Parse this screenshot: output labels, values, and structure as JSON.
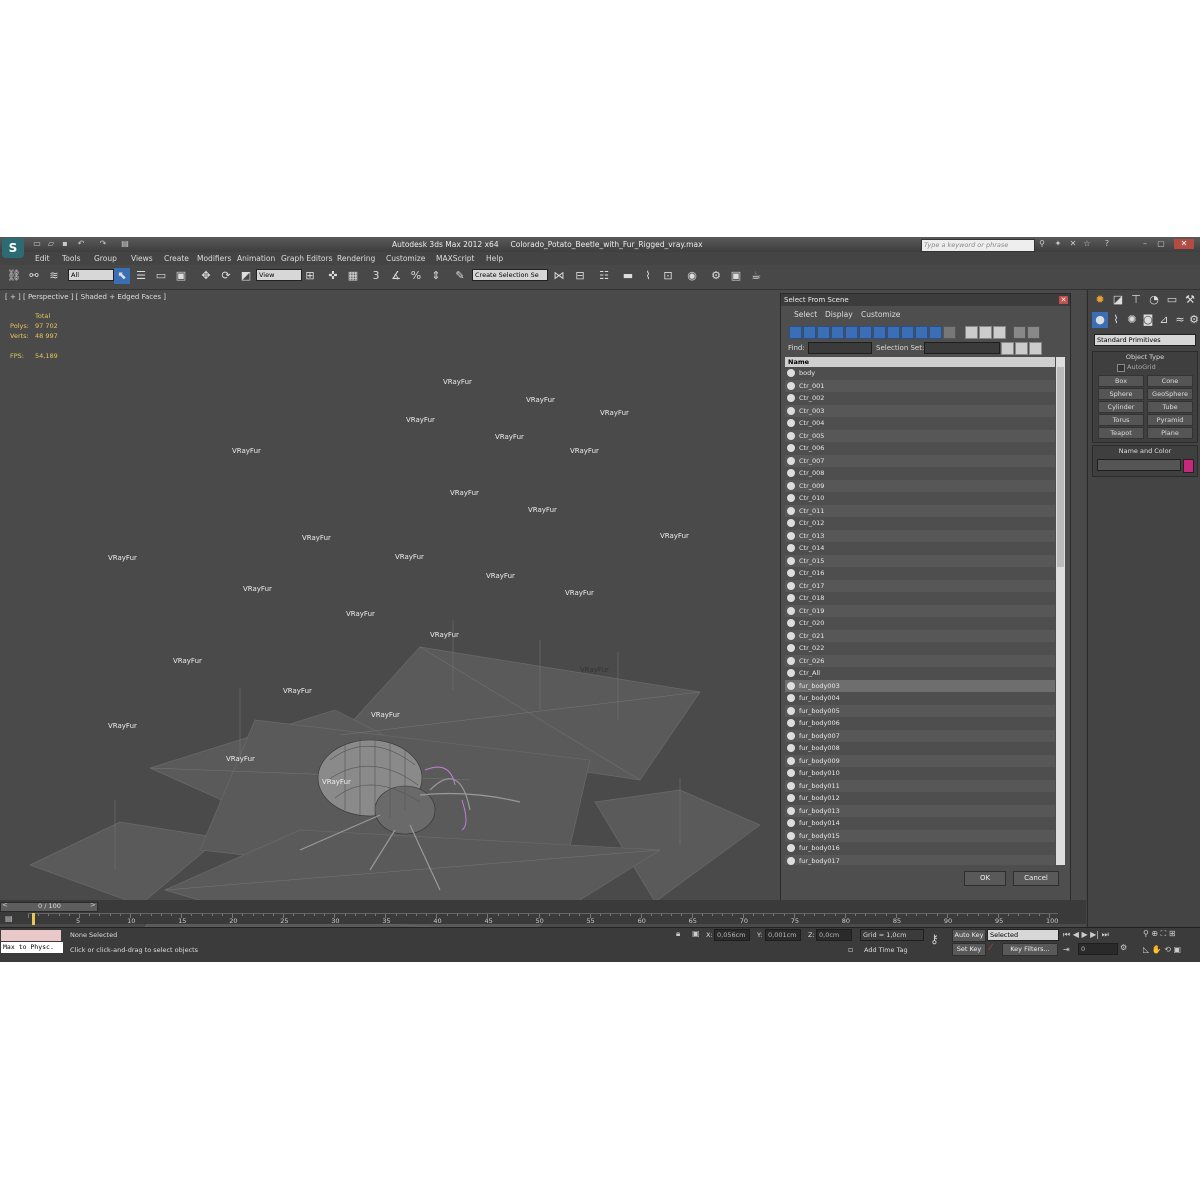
{
  "window": {
    "app_title": "Autodesk 3ds Max  2012 x64",
    "file_name": "Colorado_Potato_Beetle_with_Fur_Rigged_vray.max",
    "search_placeholder": "Type a keyword or phrase"
  },
  "menu": [
    "Edit",
    "Tools",
    "Group",
    "Views",
    "Create",
    "Modifiers",
    "Animation",
    "Graph Editors",
    "Rendering",
    "Customize",
    "MAXScript",
    "Help"
  ],
  "toolbar": {
    "selection_filter": "All",
    "ref_coord": "View",
    "named_selection": "Create Selection Se"
  },
  "viewport": {
    "label": "[ + ] [ Perspective ] [ Shaded + Edged Faces ]",
    "stats_header": "Total",
    "polys_label": "Polys:",
    "polys_value": "97 702",
    "verts_label": "Verts:",
    "verts_value": "48 997",
    "fps_label": "FPS:",
    "fps_value": "54,189",
    "object_label": "VRayFur"
  },
  "dialog": {
    "title": "Select From Scene",
    "menu": [
      "Select",
      "Display",
      "Customize"
    ],
    "find_label": "Find:",
    "selection_set_label": "Selection Set:",
    "column_name": "Name",
    "items": [
      "body",
      "Ctr_001",
      "Ctr_002",
      "Ctr_003",
      "Ctr_004",
      "Ctr_005",
      "Ctr_006",
      "Ctr_007",
      "Ctr_008",
      "Ctr_009",
      "Ctr_010",
      "Ctr_011",
      "Ctr_012",
      "Ctr_013",
      "Ctr_014",
      "Ctr_015",
      "Ctr_016",
      "Ctr_017",
      "Ctr_018",
      "Ctr_019",
      "Ctr_020",
      "Ctr_021",
      "Ctr_022",
      "Ctr_026",
      "Ctr_All",
      "fur_body003",
      "fur_body004",
      "fur_body005",
      "fur_body006",
      "fur_body007",
      "fur_body008",
      "fur_body009",
      "fur_body010",
      "fur_body011",
      "fur_body012",
      "fur_body013",
      "fur_body014",
      "fur_body015",
      "fur_body016",
      "fur_body017"
    ],
    "ok": "OK",
    "cancel": "Cancel"
  },
  "command_panel": {
    "category": "Standard Primitives",
    "object_type": "Object Type",
    "autogrid": "AutoGrid",
    "buttons": [
      "Box",
      "Cone",
      "Sphere",
      "GeoSphere",
      "Cylinder",
      "Tube",
      "Torus",
      "Pyramid",
      "Teapot",
      "Plane"
    ],
    "name_and_color": "Name and Color",
    "color": "#c8287c"
  },
  "timeline": {
    "frame": "0 / 100",
    "ticks": [
      "5",
      "10",
      "15",
      "20",
      "25",
      "30",
      "35",
      "40",
      "45",
      "50",
      "55",
      "60",
      "65",
      "70",
      "75",
      "80",
      "85",
      "90",
      "95",
      "100"
    ]
  },
  "status": {
    "script_listener": "Max to Physc.",
    "selection": "None Selected",
    "prompt": "Click or click-and-drag to select objects",
    "x_label": "X:",
    "x_value": "0,056cm",
    "y_label": "Y:",
    "y_value": "0,001cm",
    "z_label": "Z:",
    "z_value": "0,0cm",
    "grid": "Grid = 1,0cm",
    "add_time_tag": "Add Time Tag",
    "auto_key": "Auto Key",
    "set_key": "Set Key",
    "key_mode": "Selected",
    "key_filters": "Key Filters...",
    "frame_field": "0"
  }
}
